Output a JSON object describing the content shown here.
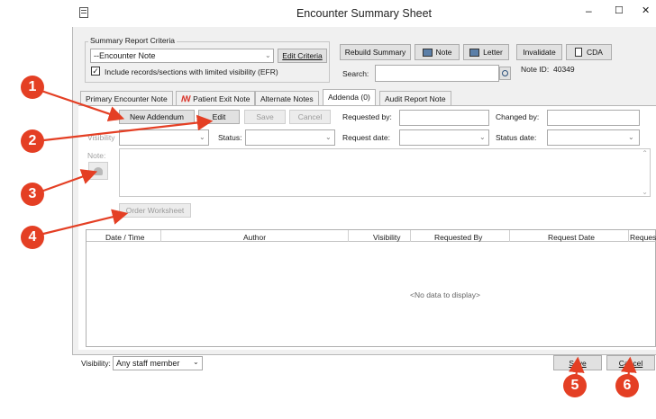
{
  "window": {
    "title": "Encounter Summary Sheet",
    "minimize": "–",
    "maximize": "☐",
    "close": "✕"
  },
  "criteria": {
    "group_label": "Summary Report Criteria",
    "dropdown_value": "--Encounter Note",
    "edit_criteria": "Edit Criteria",
    "include_limited": "Include records/sections with limited visibility (EFR)",
    "include_checked": true
  },
  "toolbar": {
    "rebuild": "Rebuild Summary",
    "note": "Note",
    "letter": "Letter",
    "invalidate": "Invalidate",
    "cda": "CDA",
    "search_label": "Search:",
    "note_id_label": "Note ID:",
    "note_id_value": "40349"
  },
  "tabs": [
    "Primary Encounter Note",
    "Patient Exit Note",
    "Alternate Notes",
    "Addenda (0)",
    "Audit Report Note"
  ],
  "addenda": {
    "new_addendum": "New Addendum",
    "edit": "Edit",
    "save": "Save",
    "cancel": "Cancel",
    "requested_by": "Requested by:",
    "changed_by": "Changed by:",
    "visibility": "Visibility",
    "status": "Status:",
    "request_date": "Request date:",
    "status_date": "Status date:",
    "note": "Note:",
    "order_worksheet": "Order Worksheet"
  },
  "grid": {
    "columns": [
      "Date / Time",
      "Author",
      "Visibility",
      "Requested By",
      "Request Date",
      "Reques"
    ],
    "empty": "<No data to display>"
  },
  "footer": {
    "visibility_label": "Visibility:",
    "visibility_value": "Any staff member",
    "save": "Save",
    "cancel": "Cancel"
  },
  "callouts": [
    "1",
    "2",
    "3",
    "4",
    "5",
    "6"
  ],
  "colors": {
    "callout": "#e43f24",
    "window_bg": "#f0f0f0",
    "tab_active_bg": "#ffffff"
  }
}
